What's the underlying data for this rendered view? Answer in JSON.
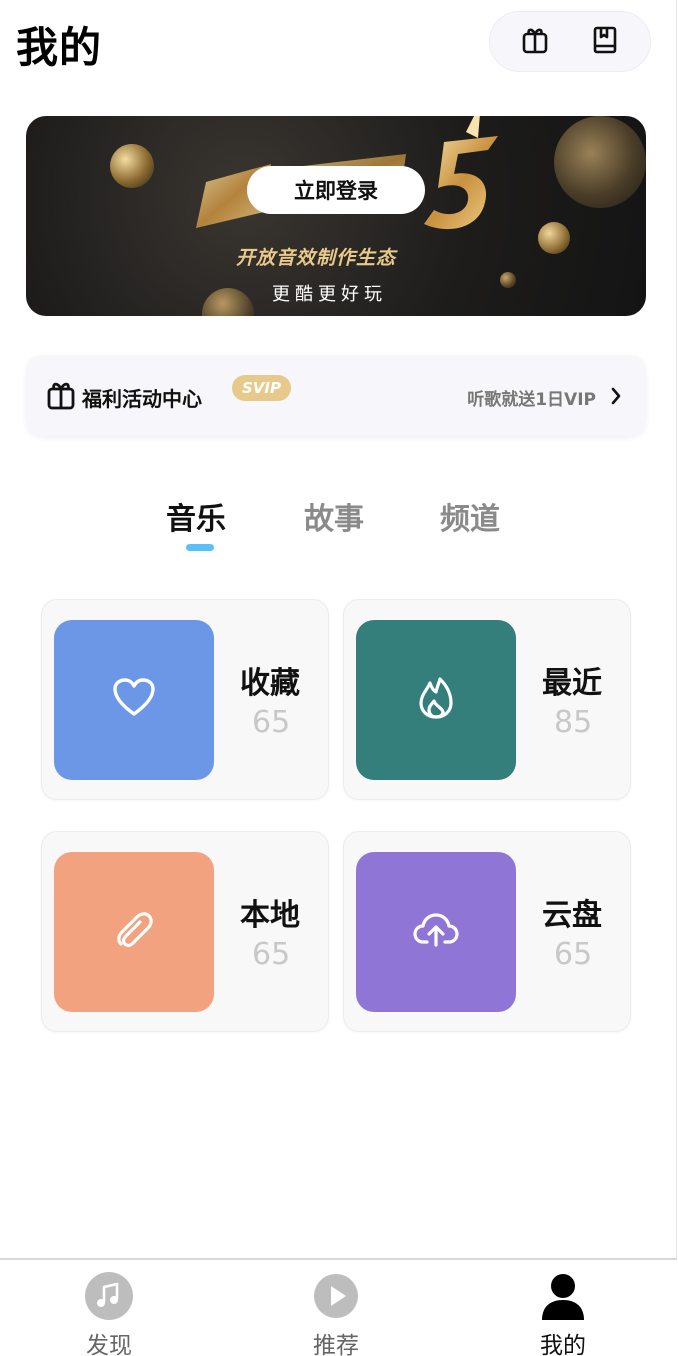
{
  "header": {
    "title": "我的",
    "actions": [
      {
        "icon": "gift-icon"
      },
      {
        "icon": "book-icon"
      }
    ]
  },
  "banner": {
    "login_label": "立即登录",
    "subtitle": "开放音效制作生态",
    "footer": "更酷更好玩",
    "accent_color": "#d6a75a"
  },
  "welfare": {
    "icon": "gift-icon",
    "title": "福利活动中心",
    "badge": "SVIP",
    "promo": "听歌就送1日VIP",
    "badge_color": "#e8c98c"
  },
  "tabs": [
    {
      "label": "音乐",
      "active": true
    },
    {
      "label": "故事",
      "active": false
    },
    {
      "label": "频道",
      "active": false
    }
  ],
  "tab_indicator_color": "#5bc0f5",
  "cards": [
    {
      "label": "收藏",
      "count": "65",
      "icon": "heart-icon",
      "color": "#6b97e6"
    },
    {
      "label": "最近",
      "count": "85",
      "icon": "flame-icon",
      "color": "#347e7c"
    },
    {
      "label": "本地",
      "count": "65",
      "icon": "paperclip-icon",
      "color": "#f2a27f"
    },
    {
      "label": "云盘",
      "count": "65",
      "icon": "cloud-upload-icon",
      "color": "#8f75d6"
    }
  ],
  "bottom_nav": [
    {
      "label": "发现",
      "icon": "music-note-icon",
      "active": false
    },
    {
      "label": "推荐",
      "icon": "play-icon",
      "active": false
    },
    {
      "label": "我的",
      "icon": "user-icon",
      "active": true
    }
  ]
}
